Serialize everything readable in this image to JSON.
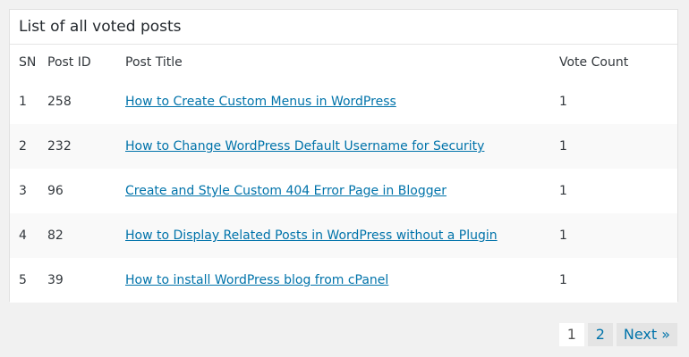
{
  "panel": {
    "title": "List of all voted posts"
  },
  "table": {
    "headers": {
      "sn": "SN",
      "post_id": "Post ID",
      "post_title": "Post Title",
      "vote_count": "Vote Count"
    },
    "rows": [
      {
        "sn": "1",
        "post_id": "258",
        "title": "How to Create Custom Menus in WordPress",
        "votes": "1"
      },
      {
        "sn": "2",
        "post_id": "232",
        "title": "How to Change WordPress Default Username for Security",
        "votes": "1"
      },
      {
        "sn": "3",
        "post_id": "96",
        "title": "Create and Style Custom 404 Error Page in Blogger",
        "votes": "1"
      },
      {
        "sn": "4",
        "post_id": "82",
        "title": "How to Display Related Posts in WordPress without a Plugin",
        "votes": "1"
      },
      {
        "sn": "5",
        "post_id": "39",
        "title": "How to install WordPress blog from cPanel",
        "votes": "1"
      }
    ]
  },
  "pagination": {
    "current": "1",
    "page2": "2",
    "next": "Next »"
  },
  "colors": {
    "link": "#0073aa",
    "background": "#f1f1f1",
    "row_alt": "#f9f9f9"
  }
}
